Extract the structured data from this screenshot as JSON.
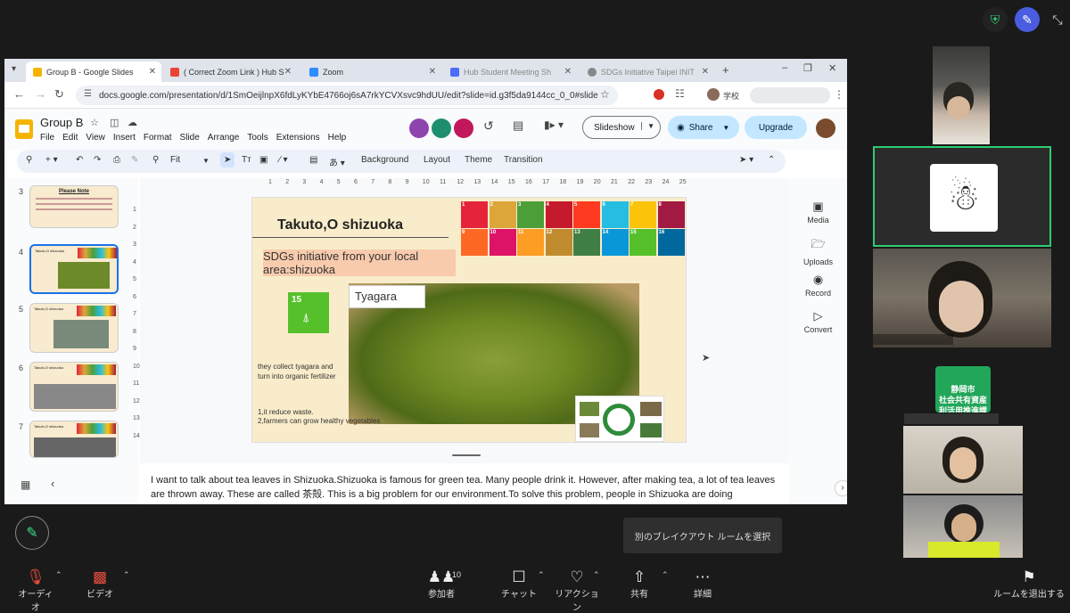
{
  "browser": {
    "tabs": [
      {
        "label": "Group B - Google Slides",
        "active": true
      },
      {
        "label": "( Correct Zoom Link ) Hub S",
        "active": false
      },
      {
        "label": "Zoom",
        "active": false
      },
      {
        "label": "Hub Student Meeting Sh",
        "active": false
      },
      {
        "label": "SDGs Initiative Taipei INIT",
        "active": false
      }
    ],
    "url": "docs.google.com/presentation/d/1SmOeijlnpX6fdLyKYbE4766oj6sA7rkYCVXsvc9hdUU/edit?slide=id.g3f5da9144cc_0_0#slide=id.g3f...",
    "profile_label": "学校"
  },
  "app": {
    "doc_title": "Group B",
    "menu": [
      "File",
      "Edit",
      "View",
      "Insert",
      "Format",
      "Slide",
      "Arrange",
      "Tools",
      "Extensions",
      "Help"
    ],
    "slideshow_label": "Slideshow",
    "share_label": "Share",
    "upgrade_label": "Upgrade",
    "zoom_value": "Fit",
    "toolbar_buttons": [
      "Background",
      "Layout",
      "Theme",
      "Transition"
    ],
    "ruler_ticks": [
      "1",
      "2",
      "3",
      "4",
      "5",
      "6",
      "7",
      "8",
      "9",
      "10",
      "11",
      "12",
      "13",
      "14",
      "15",
      "16",
      "17",
      "18",
      "19",
      "20",
      "21",
      "22",
      "23",
      "24",
      "25"
    ],
    "vruler_ticks": [
      "1",
      "2",
      "3",
      "4",
      "5",
      "6",
      "7",
      "8",
      "9",
      "10",
      "11",
      "12",
      "13",
      "14"
    ]
  },
  "filmstrip": [
    {
      "num": "3",
      "title": "Please Note"
    },
    {
      "num": "4",
      "title": "Takuto,O shizuoka"
    },
    {
      "num": "5",
      "title": "Takuto,O shizuoka"
    },
    {
      "num": "6",
      "title": "Takuto,O shizuoka"
    },
    {
      "num": "7",
      "title": "Takuto,O shizuoka"
    }
  ],
  "slide": {
    "title": "Takuto,O shizuoka",
    "subtitle": "SDGs initiative from your local area:shizuoka",
    "photo_caption": "Tyagara",
    "goal_badge": "15",
    "body1": "they collect tyagara and turn into organic fertilizer",
    "body2": "1,it reduce waste.\n2,farmers can grow healthy vegetables",
    "sdg_labels": [
      "1",
      "2",
      "3",
      "4",
      "5",
      "6",
      "7",
      "8",
      "9",
      "10",
      "11",
      "12",
      "13",
      "14",
      "15",
      "16"
    ],
    "sdg_colors": [
      "#e5243b",
      "#dda63a",
      "#4c9f38",
      "#c5192d",
      "#ff3a21",
      "#26bde2",
      "#fcc30b",
      "#a21942",
      "#fd6925",
      "#dd1367",
      "#fd9d24",
      "#bf8b2e",
      "#3f7e44",
      "#0a97d9",
      "#56c02b",
      "#00689d"
    ]
  },
  "notes": "I want to talk about tea leaves in Shizuoka.Shizuoka is famous for green tea. Many people drink it. However, after making tea, a lot of tea leaves are thrown away. These are called 茶殻. This is a big problem for our environment.To solve this problem, people in Shizuoka are doing something",
  "side_panel": [
    {
      "label": "Media",
      "icon": "media-icon"
    },
    {
      "label": "Uploads",
      "icon": "folder-icon"
    },
    {
      "label": "Record",
      "icon": "record-icon"
    },
    {
      "label": "Convert",
      "icon": "convert-icon"
    }
  ],
  "participants": {
    "name_tile_text": "静岡市\n社会共有資産\n利活用推進課"
  },
  "tooltip": "別のブレイクアウト ルームを選択",
  "bottom_bar": {
    "audio": "オーディオ",
    "video": "ビデオ",
    "participants": "参加者",
    "participant_count": "10",
    "chat": "チャット",
    "reactions": "リアクション",
    "share": "共有",
    "more": "詳細",
    "leave_room": "ルームを退出する"
  },
  "colors": {
    "zoom_green": "#2ecc71",
    "slides_yellow": "#f4b400",
    "share_blue": "#c2e7ff",
    "name_tile_green": "#22a65a"
  }
}
